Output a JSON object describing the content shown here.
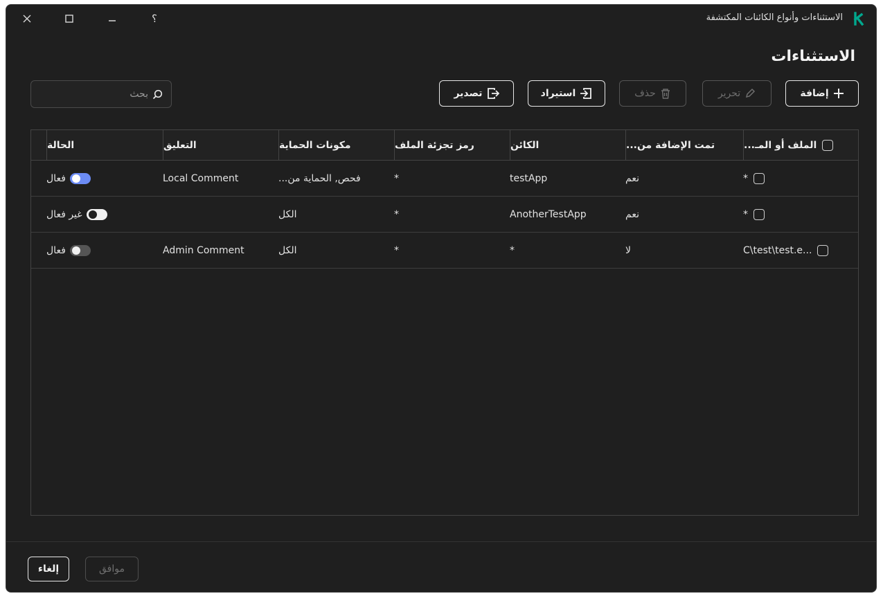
{
  "window": {
    "title": "الاستثناءات وأنواع الكائنات المكتشفة",
    "help_symbol": "؟"
  },
  "page": {
    "title": "الاستثناءات"
  },
  "toolbar": {
    "add_label": "إضافة",
    "edit_label": "تحرير",
    "delete_label": "حذف",
    "import_label": "استيراد",
    "export_label": "تصدير"
  },
  "search": {
    "placeholder": "بحث"
  },
  "table": {
    "headers": {
      "file": "الملف أو المـ...",
      "added_from": "تمت الإضافة من...",
      "object": "الكائن",
      "hash": "رمز تجزئة الملف",
      "components": "مكونات الحماية",
      "comment": "التعليق",
      "state": "الحالة"
    },
    "rows": [
      {
        "file": "*",
        "added_from": "نعم",
        "object": "testApp",
        "hash": "*",
        "components": "فحص, الحماية من...",
        "comment": "Local Comment",
        "state": "فعال",
        "toggle": "on"
      },
      {
        "file": "*",
        "added_from": "نعم",
        "object": "AnotherTestApp",
        "hash": "*",
        "components": "الكل",
        "comment": "",
        "state": "غير فعال",
        "toggle": "off"
      },
      {
        "file": "C\\test\\test.e...",
        "added_from": "لا",
        "object": "*",
        "hash": "*",
        "components": "الكل",
        "comment": "Admin Comment",
        "state": "فعال",
        "toggle": "off-dark"
      }
    ]
  },
  "footer": {
    "ok_label": "موافق",
    "cancel_label": "إلغاء"
  },
  "colors": {
    "accent": "#6c8cf5",
    "logo": "#00a88e",
    "background": "#1f1f1f"
  }
}
